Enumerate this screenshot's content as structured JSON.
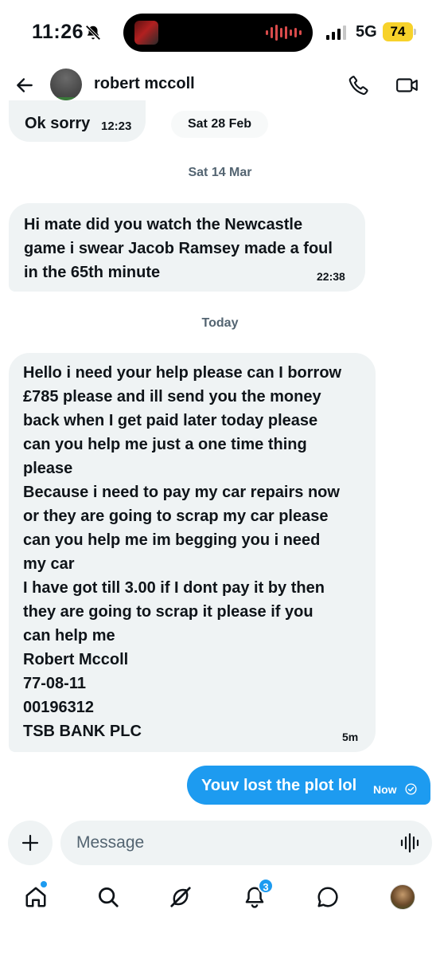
{
  "status_bar": {
    "time": "11:26",
    "network": "5G",
    "battery": "74",
    "battery_color": "#f7d22a"
  },
  "header": {
    "contact_name": "robert mccoll"
  },
  "messages": {
    "m1": {
      "text": "Ok sorry",
      "time": "12:23"
    },
    "chip_date": "Sat 28 Feb",
    "sep1": "Sat 14 Mar",
    "m2": {
      "lines": [
        "Hi mate did you watch the Newcastle",
        "game i swear Jacob Ramsey made a foul",
        "in the 65th minute"
      ],
      "time": "22:38"
    },
    "sep2": "Today",
    "m3": {
      "lines": [
        "Hello i need your help please can I borrow",
        "£785 please and ill send you the money",
        "back when I get paid later today please",
        "can you help me just a one time thing",
        "please",
        "Because i need to pay my car repairs now",
        "or they are going to scrap my car please",
        "can you help me im begging you i need",
        "my car",
        "I have got till 3.00 if I dont pay it by then",
        "they are going to scrap it please if you",
        "can help me",
        "Robert Mccoll",
        "77-08-11",
        "00196312",
        "TSB BANK PLC"
      ],
      "time": "5m"
    },
    "m4": {
      "text": "Youv lost the plot lol",
      "time": "Now"
    }
  },
  "composer": {
    "placeholder": "Message"
  },
  "tab_bar": {
    "notifications_count": "3"
  },
  "colors": {
    "accent": "#1d9bf0",
    "incoming_bubble": "#eff3f4",
    "secondary_text": "#536471"
  }
}
